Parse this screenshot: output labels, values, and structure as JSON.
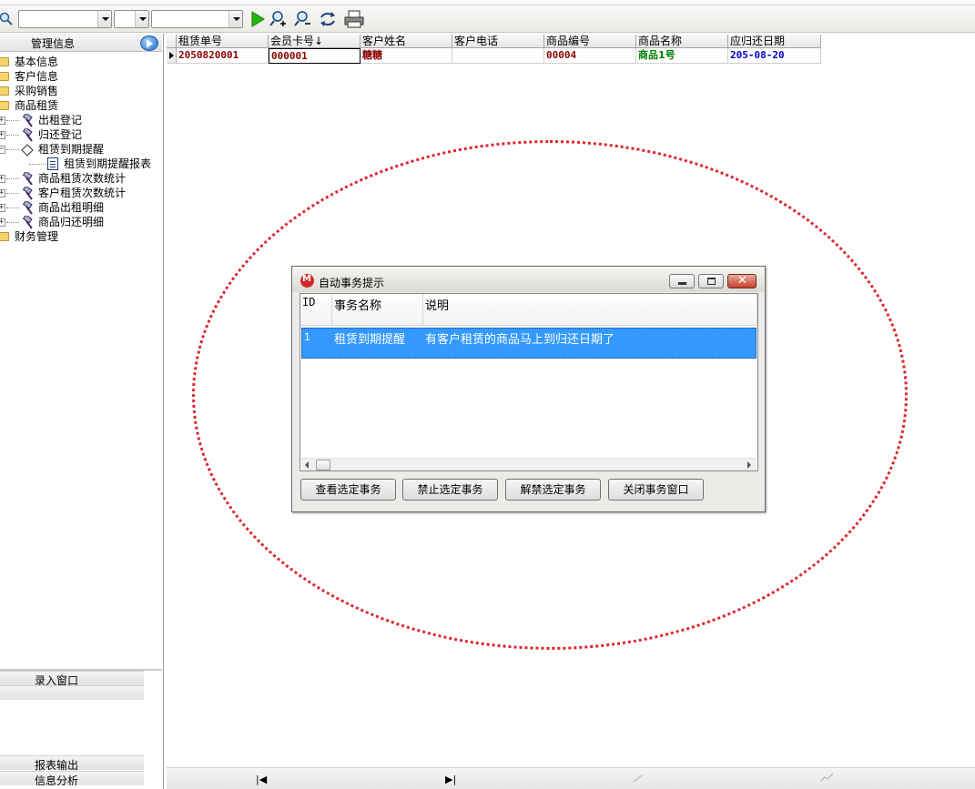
{
  "left_panel": {
    "title": "管理信息",
    "tree": [
      {
        "label": "基本信息",
        "type": "folder"
      },
      {
        "label": "客户信息",
        "type": "folder"
      },
      {
        "label": "采购销售",
        "type": "folder"
      },
      {
        "label": "商品租赁",
        "type": "folder"
      },
      {
        "label": "出租登记",
        "type": "tool"
      },
      {
        "label": "归还登记",
        "type": "tool"
      },
      {
        "label": "租赁到期提醒",
        "type": "tool"
      },
      {
        "label": "租赁到期提醒报表",
        "type": "report"
      },
      {
        "label": "商品租赁次数统计",
        "type": "tool"
      },
      {
        "label": "客户租赁次数统计",
        "type": "tool"
      },
      {
        "label": "商品出租明细",
        "type": "tool"
      },
      {
        "label": "商品归还明细",
        "type": "tool"
      },
      {
        "label": "财务管理",
        "type": "folder"
      }
    ],
    "sections": [
      "录入窗口",
      "报表输出",
      "信息分析"
    ]
  },
  "grid": {
    "columns": [
      "租赁单号",
      "会员卡号↓",
      "客户姓名",
      "客户电话",
      "商品编号",
      "商品名称",
      "应归还日期"
    ],
    "rows": [
      [
        "2050820001",
        "000001",
        "糖糖",
        "",
        "00004",
        "商品1号",
        "205-08-20"
      ]
    ],
    "cell_colors": [
      "#8b0000",
      "#8b0000",
      "#8b0000",
      "#8b0000",
      "#8b0000",
      "#008000",
      "#0000cc"
    ]
  },
  "bottom_nav": {
    "first": "|◀",
    "last": "▶|"
  },
  "dialog": {
    "title": "自动事务提示",
    "columns": [
      "ID",
      "事务名称",
      "说明"
    ],
    "rows": [
      {
        "id": "1",
        "name": "租赁到期提醒",
        "desc": "有客户租赁的商品马上到归还日期了"
      }
    ],
    "buttons": [
      "查看选定事务",
      "禁止选定事务",
      "解禁选定事务",
      "关闭事务窗口"
    ]
  },
  "colors": {
    "selection": "#3399ff",
    "annotation": "#e0252b"
  }
}
